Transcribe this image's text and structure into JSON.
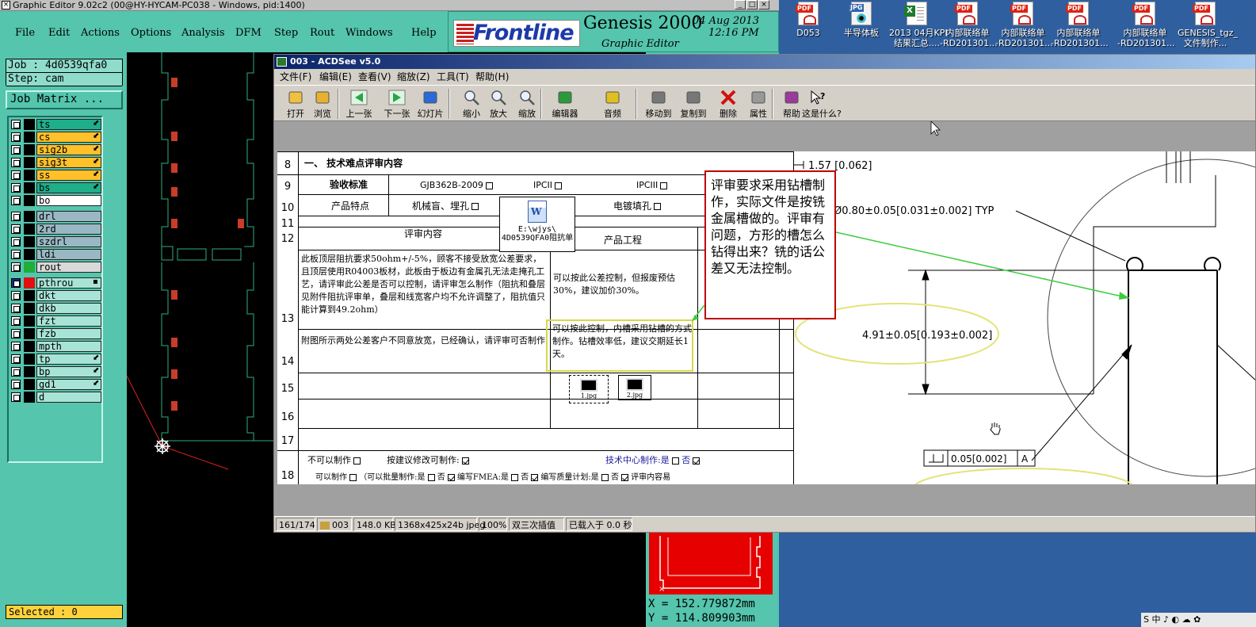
{
  "genesis": {
    "title": "Graphic Editor 9.02c2 (00@HY-HYCAM-PC038 - Windows, pid:1400)",
    "menu": [
      "File",
      "Edit",
      "Actions",
      "Options",
      "Analysis",
      "DFM",
      "Step",
      "Rout",
      "Windows",
      "Help"
    ],
    "logo_text": "Frontline",
    "product": "Genesis 2000",
    "subtitle": "Graphic Editor",
    "date": "04 Aug 2013",
    "time": "12:16 PM",
    "job": "Job : 4d0539qfa0",
    "step": "Step: cam",
    "job_matrix_button": "Job Matrix ...",
    "layers": [
      {
        "name": "ts",
        "color": "#1fae8a",
        "flag": "⬋"
      },
      {
        "name": "cs",
        "color": "#ffc02a",
        "flag": "⬋"
      },
      {
        "name": "sig2b",
        "color": "#ffc02a",
        "flag": "⬋"
      },
      {
        "name": "sig3t",
        "color": "#ffc02a",
        "flag": "⬋"
      },
      {
        "name": "ss",
        "color": "#ffc02a",
        "flag": "⬋"
      },
      {
        "name": "bs",
        "color": "#1fae8a",
        "flag": "⬋"
      },
      {
        "name": "bo",
        "color": "#ffffff",
        "flag": ""
      },
      {
        "name": "drl",
        "color": "#9ab8c4",
        "flag": ""
      },
      {
        "name": "2rd",
        "color": "#9ab8c4",
        "flag": ""
      },
      {
        "name": "szdrl",
        "color": "#9ab8c4",
        "flag": ""
      },
      {
        "name": "ldi",
        "color": "#9ab8c4",
        "flag": ""
      },
      {
        "name": "rout",
        "color": "#d9d9d9",
        "flag": ""
      },
      {
        "name": "pthrou",
        "color": "#a8e4d6",
        "flag": "▪"
      },
      {
        "name": "dkt",
        "color": "#a8e4d6",
        "flag": ""
      },
      {
        "name": "dkb",
        "color": "#a8e4d6",
        "flag": ""
      },
      {
        "name": "fzt",
        "color": "#a8e4d6",
        "flag": ""
      },
      {
        "name": "fzb",
        "color": "#a8e4d6",
        "flag": ""
      },
      {
        "name": "mpth",
        "color": "#a8e4d6",
        "flag": ""
      },
      {
        "name": "tp",
        "color": "#a8e4d6",
        "flag": "⬋"
      },
      {
        "name": "bp",
        "color": "#a8e4d6",
        "flag": "⬋"
      },
      {
        "name": "gd1",
        "color": "#a8e4d6",
        "flag": "⬋"
      },
      {
        "name": "d",
        "color": "#a8e4d6",
        "flag": ""
      }
    ],
    "selected": "Selected : 0",
    "coord_x": "X  =  152.779872mm",
    "coord_y": "Y  =  114.809903mm"
  },
  "desktop_icons": [
    {
      "label1": "D053",
      "label2": "",
      "kind": "pdf"
    },
    {
      "label1": "半导体板",
      "label2": "",
      "kind": "jpg"
    },
    {
      "label1": "2013 04月KPI",
      "label2": "结果汇总....",
      "kind": "xls"
    },
    {
      "label1": "内部联络单",
      "label2": "-RD201301...",
      "kind": "pdf"
    },
    {
      "label1": "内部联络单",
      "label2": "-RD201301...",
      "kind": "pdf"
    },
    {
      "label1": "内部联络单",
      "label2": "-RD201301...",
      "kind": "pdf"
    },
    {
      "label1": "内部联络单",
      "label2": "-RD201301...",
      "kind": "pdf"
    },
    {
      "label1": "GENESIS_tgz_",
      "label2": "文件制作...",
      "kind": "pdf"
    }
  ],
  "acdsee": {
    "title": "003 - ACDSee v5.0",
    "menu": [
      "文件(F)",
      "编辑(E)",
      "查看(V)",
      "缩放(Z)",
      "工具(T)",
      "帮助(H)"
    ],
    "toolbar": [
      "打开",
      "浏览",
      "上一张",
      "下一张",
      "幻灯片",
      "缩小",
      "放大",
      "缩放",
      "编辑器",
      "音频",
      "移动到",
      "复制到",
      "删除",
      "属性",
      "帮助",
      "这是什么?"
    ],
    "status": [
      "161/174",
      "003",
      "148.0 KB",
      "1368x425x24b jpeg",
      "100%",
      "双三次插值",
      "已载入于 0.0 秒"
    ]
  },
  "doc": {
    "section_title": "一、 技术难点评审内容",
    "row_numbers": [
      "8",
      "9",
      "10",
      "11",
      "12",
      "13",
      "14",
      "15",
      "16",
      "17",
      "18"
    ],
    "accept_label": "验收标准",
    "std1": "GJB362B-2009",
    "std2": "IPCII",
    "std3": "IPCIII",
    "feature_label": "产品特点",
    "feature_val": "机械盲、埋孔",
    "plating": "电镀填孔",
    "review_content": "评审内容",
    "product_eng": "产品工程",
    "attach_path": "E:\\wjys\\",
    "attach_name": "4D0539QFA0阻抗单",
    "req13": "此板顶层阻抗要求50ohm+/-5%，顾客不接受放宽公差要求，且顶层使用R04003板材，此板由于板边有金属孔无法走掩孔工艺，请评审此公差是否可以控制，请评审怎么制作（阻抗和叠层见附件阻抗评审单，叠层和线宽客户均不允许调整了，阻抗值只能计算到49.2ohm）",
    "resp13": "可以按此公差控制，但报废预估30%，建议加价30%。",
    "req14": "附图所示两处公差客户不同意放宽，已经确认，请评审可否制作",
    "resp14": "可以按此控制，内槽采用钻槽的方式制作。钻槽效率低，建议交期延长1天。",
    "thumb1": "1.jpg",
    "thumb2": "2.jpg",
    "cannot": "不可以制作",
    "by_suggest": "按建议修改可制作:",
    "tech_center": "技术中心制作:是",
    "no": "否",
    "can": "可以制作",
    "batch": "（可以批量制作:是",
    "fmea": "编写FMEA:是",
    "quality": "编写质量计划:是",
    "review_tail": "评审内容易",
    "annotation": "评审要求采用钻槽制作，实际文件是按铣金属槽做的。评审有问题，方形的槽怎么钻得出来？铣的话公差又无法控制。"
  },
  "drawing": {
    "dim1": "1.57",
    "dim1b": "0.062",
    "dim2": "Ø0.80±0.05",
    "dim2b": "0.031±0.002",
    "dim2c": "TYP",
    "dim3": "4.91±0.05",
    "dim3b": "0.193±0.002",
    "dim4": "0.05",
    "dim4b": "0.002",
    "dim4c": "A"
  },
  "tray": "S 中 ♪ ◐ ☁ ✿"
}
